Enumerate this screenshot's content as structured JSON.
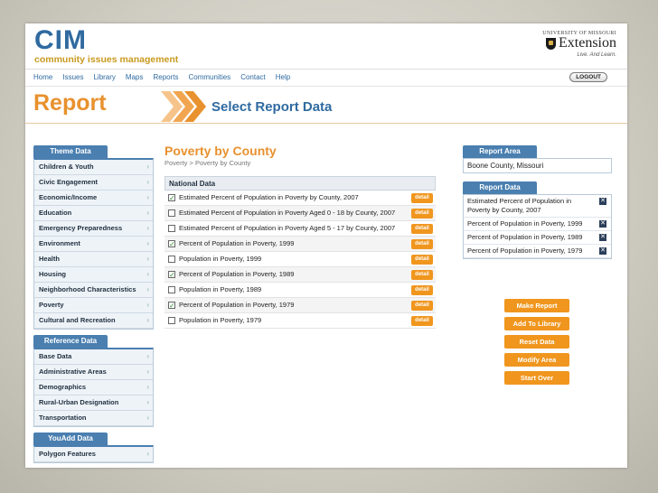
{
  "brand": {
    "name": "CIM",
    "subtitle": "community issues management"
  },
  "university": {
    "line": "UNIVERSITY OF MISSOURI",
    "name": "Extension",
    "tagline": "Live. And Learn."
  },
  "nav": {
    "items": [
      "Home",
      "Issues",
      "Library",
      "Maps",
      "Reports",
      "Communities",
      "Contact",
      "Help"
    ],
    "logout": "LOGOUT"
  },
  "banner": {
    "title": "Report",
    "step": "Select Report Data"
  },
  "sidebar": {
    "theme_header": "Theme Data",
    "theme_items": [
      "Children & Youth",
      "Civic Engagement",
      "Economic/Income",
      "Education",
      "Emergency Preparedness",
      "Environment",
      "Health",
      "Housing",
      "Neighborhood Characteristics",
      "Poverty",
      "Cultural and Recreation"
    ],
    "reference_header": "Reference Data",
    "reference_items": [
      "Base Data",
      "Administrative Areas",
      "Demographics",
      "Rural-Urban Designation",
      "Transportation"
    ],
    "youadd_header": "YouAdd Data",
    "youadd_items": [
      "Polygon Features"
    ],
    "arrow": "›"
  },
  "main": {
    "title": "Poverty by County",
    "breadcrumb": "Poverty > Poverty by County",
    "panel_header": "National Data",
    "detail_label": "detail",
    "rows": [
      {
        "label": "Estimated Percent of Population in Poverty by County, 2007",
        "checked": true
      },
      {
        "label": "Estimated Percent of Population in Poverty Aged 0 - 18 by County, 2007",
        "checked": false
      },
      {
        "label": "Estimated Percent of Population in Poverty Aged 5 - 17 by County, 2007",
        "checked": false
      },
      {
        "label": "Percent of Population in Poverty, 1999",
        "checked": true
      },
      {
        "label": "Population in Poverty, 1999",
        "checked": false
      },
      {
        "label": "Percent of Population in Poverty, 1989",
        "checked": true
      },
      {
        "label": "Population in Poverty, 1989",
        "checked": false
      },
      {
        "label": "Percent of Population in Poverty, 1979",
        "checked": true
      },
      {
        "label": "Population in Poverty, 1979",
        "checked": false
      }
    ]
  },
  "report_area": {
    "header": "Report Area",
    "value": "Boone County, Missouri"
  },
  "report_data": {
    "header": "Report Data",
    "items": [
      "Estimated Percent of Population in Poverty by County, 2007",
      "Percent of Population in Poverty, 1999",
      "Percent of Population in Poverty, 1989",
      "Percent of Population in Poverty, 1979"
    ]
  },
  "actions": [
    "Make Report",
    "Add To Library",
    "Reset Data",
    "Modify Area",
    "Start Over"
  ],
  "colors": {
    "brand_blue": "#2f6aa0",
    "accent_orange": "#e8912e",
    "button_orange": "#f0961e",
    "header_blue": "#4a7fb0"
  }
}
